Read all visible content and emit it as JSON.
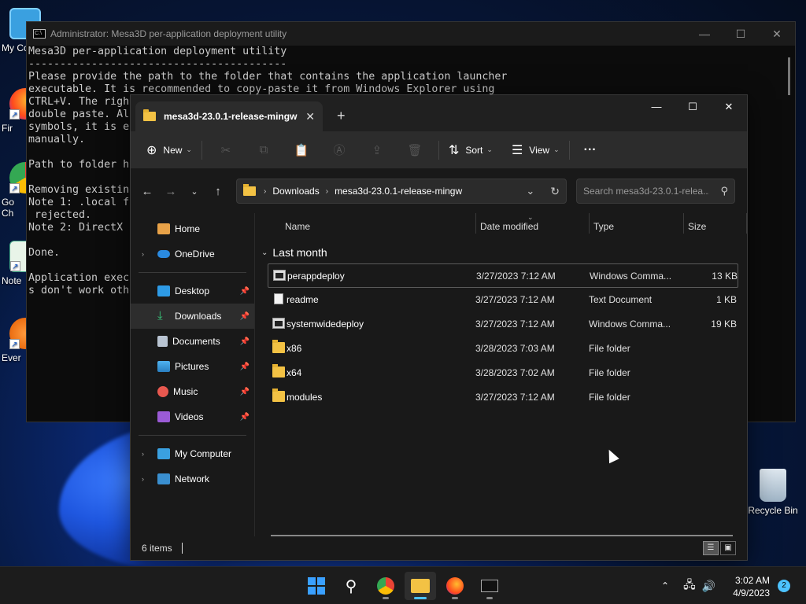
{
  "desktop": {
    "icons": [
      {
        "label": "My Co"
      },
      {
        "label": "Fir"
      },
      {
        "label": "Go\nCh"
      },
      {
        "label": "Note"
      },
      {
        "label": "Ever"
      },
      {
        "label": "Recycle Bin"
      }
    ]
  },
  "cmd": {
    "title": "Administrator:  Mesa3D per-application deployment utility",
    "text": "Mesa3D per-application deployment utility\n-----------------------------------------\nPlease provide the path to the folder that contains the application launcher\nexecutable. It is recommended to copy-paste it from Windows Explorer using\nCTRL+V. The right\ndouble paste. Als\nsymbols, it is e\nmanually.\n\nPath to folder ho\n\nRemoving existing\nNote 1: .local fi                                                                      ent is\n rejected.\nNote 2: DirectX I\n\nDone.\n\nApplication exec                                                                       thing\ns don't work othe",
    "controls": {
      "minimize": "—",
      "maximize": "☐",
      "close": "✕"
    }
  },
  "explorer": {
    "tab_title": "mesa3d-23.0.1-release-mingw",
    "tab_close": "✕",
    "new_tab": "+",
    "window_controls": {
      "minimize": "—",
      "maximize": "☐",
      "close": "✕"
    },
    "toolbar": {
      "new_label": "New",
      "sort_label": "Sort",
      "view_label": "View",
      "more_label": "···"
    },
    "breadcrumb": [
      "Downloads",
      "mesa3d-23.0.1-release-mingw"
    ],
    "search": {
      "placeholder": "Search mesa3d-23.0.1-relea..."
    },
    "sidebar": {
      "home": "Home",
      "onedrive": "OneDrive",
      "desktop": "Desktop",
      "downloads": "Downloads",
      "documents": "Documents",
      "pictures": "Pictures",
      "music": "Music",
      "videos": "Videos",
      "my_computer": "My Computer",
      "network": "Network"
    },
    "columns": {
      "name": "Name",
      "date": "Date modified",
      "type": "Type",
      "size": "Size"
    },
    "group_label": "Last month",
    "files": [
      {
        "name": "perappdeploy",
        "date": "3/27/2023 7:12 AM",
        "type": "Windows Comma...",
        "size": "13 KB",
        "icon": "cmd-file-icon"
      },
      {
        "name": "readme",
        "date": "3/27/2023 7:12 AM",
        "type": "Text Document",
        "size": "1 KB",
        "icon": "text-file-icon"
      },
      {
        "name": "systemwidedeploy",
        "date": "3/27/2023 7:12 AM",
        "type": "Windows Comma...",
        "size": "19 KB",
        "icon": "cmd-file-icon"
      },
      {
        "name": "x86",
        "date": "3/28/2023 7:03 AM",
        "type": "File folder",
        "size": "",
        "icon": "folder-icon"
      },
      {
        "name": "x64",
        "date": "3/28/2023 7:02 AM",
        "type": "File folder",
        "size": "",
        "icon": "folder-icon"
      },
      {
        "name": "modules",
        "date": "3/27/2023 7:12 AM",
        "type": "File folder",
        "size": "",
        "icon": "folder-icon"
      }
    ],
    "status": "6 items"
  },
  "taskbar": {
    "time": "3:02 AM",
    "date": "4/9/2023",
    "notifications": "2"
  },
  "colors": {
    "accent": "#4cc2ff",
    "folder": "#f3c244",
    "explorer_bg": "#191919",
    "cmd_bg": "#0c0c0c"
  }
}
